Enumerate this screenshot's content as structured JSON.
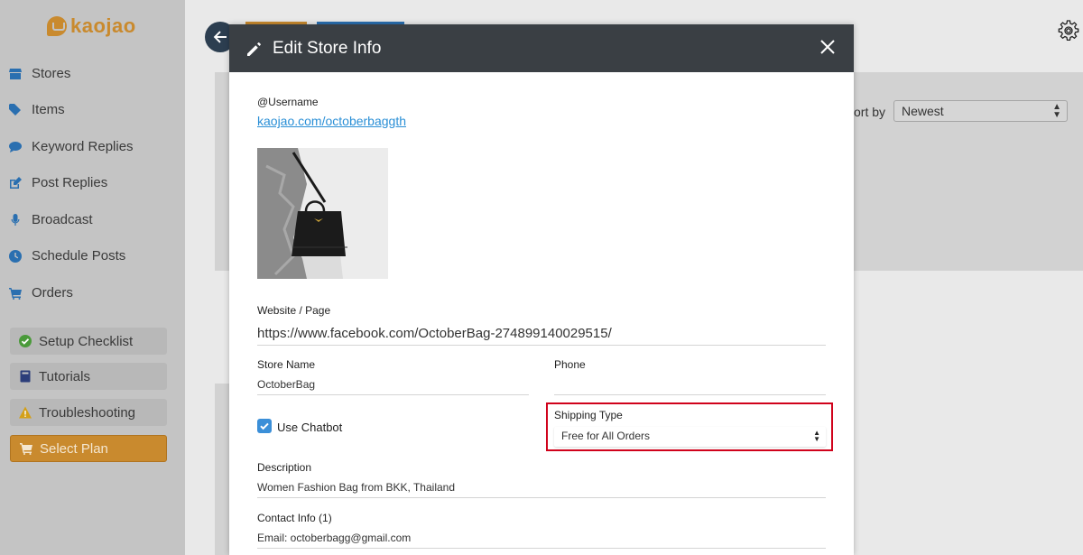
{
  "app": {
    "logo_text": "kaojao",
    "brand_color": "#c98a2e"
  },
  "sidebar": {
    "items": [
      {
        "label": "Stores",
        "icon": "store-icon"
      },
      {
        "label": "Items",
        "icon": "tags-icon"
      },
      {
        "label": "Keyword Replies",
        "icon": "chat-bubble-icon"
      },
      {
        "label": "Post Replies",
        "icon": "edit-icon"
      },
      {
        "label": "Broadcast",
        "icon": "microphone-icon"
      },
      {
        "label": "Schedule Posts",
        "icon": "clock-icon"
      },
      {
        "label": "Orders",
        "icon": "cart-icon"
      }
    ],
    "buttons": [
      {
        "label": "Setup Checklist",
        "icon": "check-circle-icon"
      },
      {
        "label": "Tutorials",
        "icon": "book-icon"
      },
      {
        "label": "Troubleshooting",
        "icon": "warning-icon"
      },
      {
        "label": "Select Plan",
        "icon": "cart-icon"
      }
    ]
  },
  "background": {
    "sort_label": "ort by",
    "sort_value": "Newest"
  },
  "modal": {
    "title": "Edit Store Info",
    "username_label": "@Username",
    "username_link": "kaojao.com/octoberbaggth",
    "website_label": "Website / Page",
    "website_value": "https://www.facebook.com/OctoberBag-274899140029515/",
    "store_name_label": "Store Name",
    "store_name_value": "OctoberBag",
    "phone_label": "Phone",
    "phone_value": "",
    "use_chatbot_label": "Use Chatbot",
    "use_chatbot_checked": true,
    "shipping_type_label": "Shipping Type",
    "shipping_type_value": "Free for All Orders",
    "description_label": "Description",
    "description_value": "Women Fashion Bag from BKK, Thailand",
    "contact_label": "Contact Info (1)",
    "contact_value": "Email: octoberbagg@gmail.com"
  },
  "colors": {
    "header": "#3a3f44",
    "link": "#2a8fd6",
    "highlight": "#d0021b",
    "checkbox": "#3b8fd8"
  }
}
